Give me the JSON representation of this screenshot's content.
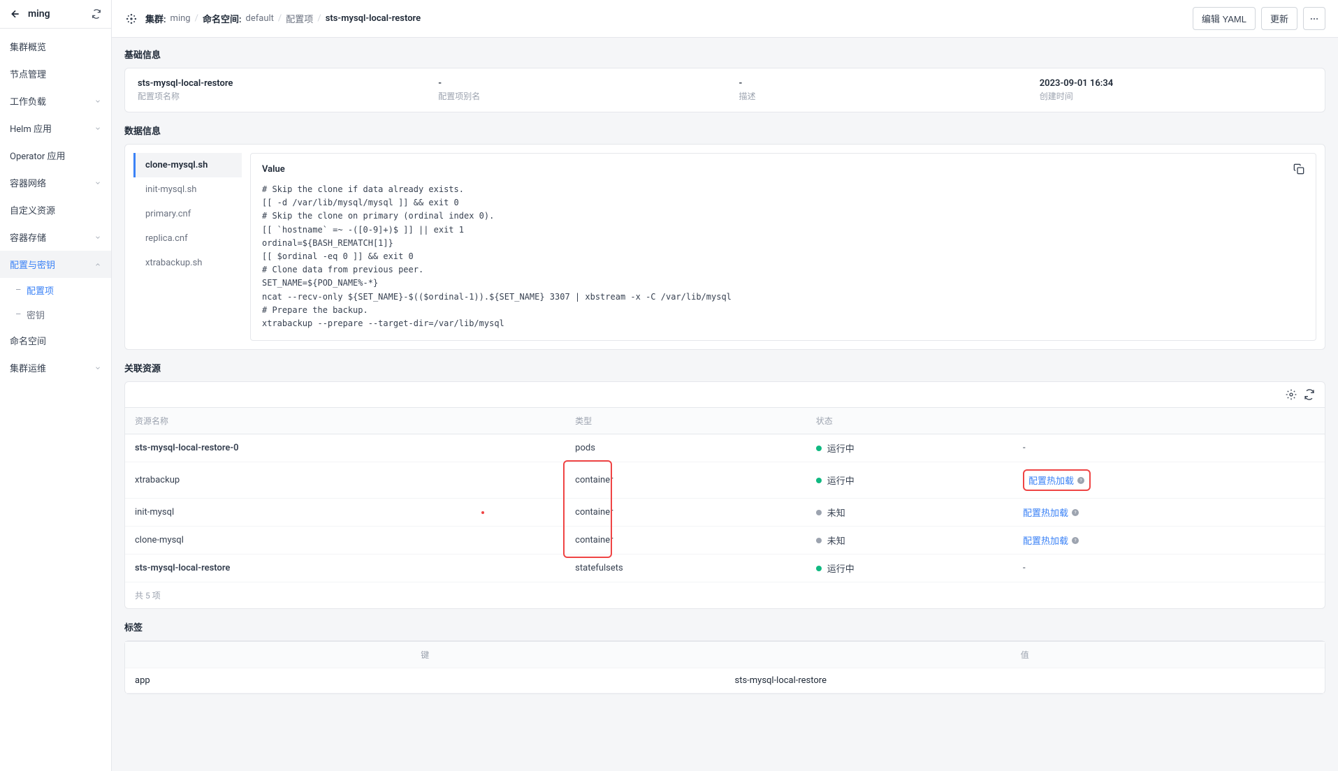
{
  "sidebar": {
    "cluster_name": "ming",
    "nav": {
      "overview": "集群概览",
      "nodes": "节点管理",
      "workloads": "工作负载",
      "helm": "Helm 应用",
      "operator": "Operator 应用",
      "network": "容器网络",
      "custom": "自定义资源",
      "storage": "容器存储",
      "config_secret": "配置与密钥",
      "configmap": "配置项",
      "secret": "密钥",
      "namespace": "命名空间",
      "ops": "集群运维"
    }
  },
  "breadcrumb": {
    "cluster_label": "集群:",
    "cluster_value": "ming",
    "ns_label": "命名空间:",
    "ns_value": "default",
    "config_label": "配置项",
    "current": "sts-mysql-local-restore"
  },
  "actions": {
    "edit_yaml": "编辑 YAML",
    "update": "更新"
  },
  "sections": {
    "basic": "基础信息",
    "data": "数据信息",
    "resources": "关联资源",
    "labels": "标签"
  },
  "basic_info": {
    "name": {
      "value": "sts-mysql-local-restore",
      "label": "配置项名称"
    },
    "alias": {
      "value": "-",
      "label": "配置项别名"
    },
    "desc": {
      "value": "-",
      "label": "描述"
    },
    "created": {
      "value": "2023-09-01 16:34",
      "label": "创建时间"
    }
  },
  "files": [
    "clone-mysql.sh",
    "init-mysql.sh",
    "primary.cnf",
    "replica.cnf",
    "xtrabackup.sh"
  ],
  "value_panel": {
    "title": "Value",
    "code": "# Skip the clone if data already exists.\n[[ -d /var/lib/mysql/mysql ]] && exit 0\n# Skip the clone on primary (ordinal index 0).\n[[ `hostname` =~ -([0-9]+)$ ]] || exit 1\nordinal=${BASH_REMATCH[1]}\n[[ $ordinal -eq 0 ]] && exit 0\n# Clone data from previous peer.\nSET_NAME=${POD_NAME%-*}\nncat --recv-only ${SET_NAME}-$(($ordinal-1)).${SET_NAME} 3307 | xbstream -x -C /var/lib/mysql\n# Prepare the backup.\nxtrabackup --prepare --target-dir=/var/lib/mysql"
  },
  "resources_table": {
    "headers": {
      "name": "资源名称",
      "type": "类型",
      "status": "状态",
      "action": ""
    },
    "rows": [
      {
        "name": "sts-mysql-local-restore-0",
        "type": "pods",
        "status_color": "green",
        "status_text": "运行中",
        "action": "-",
        "bold": true
      },
      {
        "name": "xtrabackup",
        "type": "container",
        "status_color": "green",
        "status_text": "运行中",
        "action": "配置热加载",
        "highlight_type": true,
        "highlight_action": true
      },
      {
        "name": "init-mysql",
        "type": "container",
        "status_color": "gray",
        "status_text": "未知",
        "action": "配置热加载",
        "highlight_type": true
      },
      {
        "name": "clone-mysql",
        "type": "container",
        "status_color": "gray",
        "status_text": "未知",
        "action": "配置热加载",
        "highlight_type": true
      },
      {
        "name": "sts-mysql-local-restore",
        "type": "statefulsets",
        "status_color": "green",
        "status_text": "运行中",
        "action": "-",
        "bold": true
      }
    ],
    "footer": "共 5 项"
  },
  "labels_table": {
    "headers": {
      "key": "键",
      "value": "值"
    },
    "rows": [
      {
        "key": "app",
        "value": "sts-mysql-local-restore"
      }
    ]
  }
}
